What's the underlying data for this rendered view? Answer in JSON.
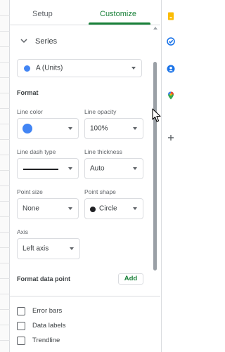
{
  "tabs": {
    "setup": "Setup",
    "customize": "Customize"
  },
  "section": {
    "title": "Series"
  },
  "series_select": {
    "value": "A (Units)",
    "color": "#4285f4"
  },
  "format": {
    "heading": "Format",
    "line_color": {
      "label": "Line color",
      "value_color": "#4285f4"
    },
    "line_opacity": {
      "label": "Line opacity",
      "value": "100%"
    },
    "line_dash_type": {
      "label": "Line dash type"
    },
    "line_thickness": {
      "label": "Line thickness",
      "value": "Auto"
    },
    "point_size": {
      "label": "Point size",
      "value": "None"
    },
    "point_shape": {
      "label": "Point shape",
      "value": "Circle"
    },
    "axis": {
      "label": "Axis",
      "value": "Left axis"
    }
  },
  "format_data_point": {
    "label": "Format data point",
    "add_button": "Add"
  },
  "checkboxes": [
    {
      "label": "Error bars",
      "checked": false
    },
    {
      "label": "Data labels",
      "checked": false
    },
    {
      "label": "Trendline",
      "checked": false
    }
  ],
  "rail": {
    "icons": [
      "keep-icon",
      "tasks-icon",
      "contacts-icon",
      "maps-icon",
      "add-icon"
    ]
  },
  "colors": {
    "accent": "#188038",
    "series_blue": "#4285f4"
  }
}
